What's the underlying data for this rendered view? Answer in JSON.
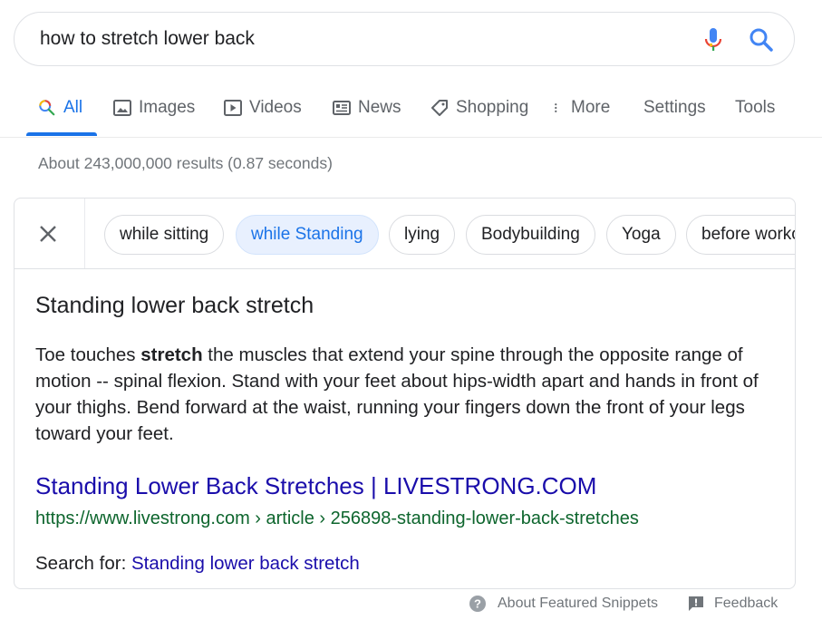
{
  "search": {
    "query": "how to stretch lower back"
  },
  "tabs": [
    {
      "label": "All",
      "icon": "search-icon"
    },
    {
      "label": "Images",
      "icon": "image-icon"
    },
    {
      "label": "Videos",
      "icon": "play-icon"
    },
    {
      "label": "News",
      "icon": "news-icon"
    },
    {
      "label": "Shopping",
      "icon": "tag-icon"
    },
    {
      "label": "More",
      "icon": "more-vert-icon"
    },
    {
      "label": "Settings"
    },
    {
      "label": "Tools"
    }
  ],
  "results_stats": "About 243,000,000 results (0.87 seconds)",
  "chips": [
    {
      "label": "while sitting",
      "selected": false
    },
    {
      "label": "while Standing",
      "selected": true
    },
    {
      "label": "lying",
      "selected": false
    },
    {
      "label": "Bodybuilding",
      "selected": false
    },
    {
      "label": "Yoga",
      "selected": false
    },
    {
      "label": "before workout",
      "selected": false
    }
  ],
  "snippet": {
    "title": "Standing lower back stretch",
    "text_before": "Toe touches ",
    "text_bold": "stretch",
    "text_after": " the muscles that extend your spine through the opposite range of motion -- spinal flexion. Stand with your feet about hips-width apart and hands in front of your thighs. Bend forward at the waist, running your fingers down the front of your legs toward your feet.",
    "link_title": "Standing Lower Back Stretches | LIVESTRONG.COM",
    "url": "https://www.livestrong.com › article › 256898-standing-lower-back-stretches",
    "search_for_label": "Search for: ",
    "search_for_link": "Standing lower back stretch"
  },
  "footer": {
    "about": "About Featured Snippets",
    "feedback": "Feedback"
  },
  "colors": {
    "accent": "#1a73e8",
    "link": "#1a0dab",
    "url": "#0d652d",
    "chip_selected_bg": "#e8f0fe"
  }
}
